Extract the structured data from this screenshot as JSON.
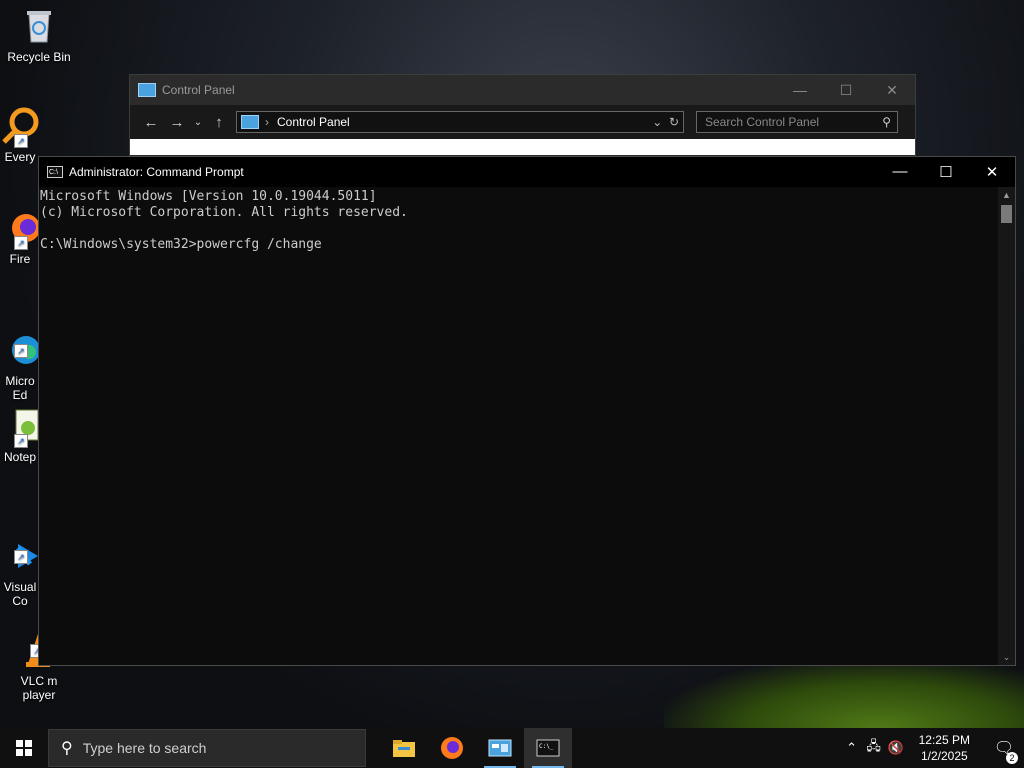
{
  "desktop": {
    "icons": [
      {
        "label": "Recycle Bin",
        "icon": "recycle-bin-icon"
      },
      {
        "label": "Every",
        "icon": "everything-icon"
      },
      {
        "label": "Fire",
        "icon": "firefox-icon"
      },
      {
        "label": "Micro\nEd",
        "icon": "edge-icon"
      },
      {
        "label": "Notep",
        "icon": "notepad-icon"
      },
      {
        "label": "Visual\nCo",
        "icon": "vscode-icon"
      },
      {
        "label": "VLC m\nplayer",
        "icon": "vlc-icon"
      }
    ]
  },
  "control_panel": {
    "title": "Control Panel",
    "address": "Control Panel",
    "search_placeholder": "Search Control Panel",
    "minimize": "—",
    "maximize": "☐",
    "close": "✕"
  },
  "cmd": {
    "title": "Administrator: Command Prompt",
    "minimize": "—",
    "maximize": "☐",
    "close": "✕",
    "lines": [
      "Microsoft Windows [Version 10.0.19044.5011]",
      "(c) Microsoft Corporation. All rights reserved.",
      "",
      "C:\\Windows\\system32>powercfg /change"
    ]
  },
  "taskbar": {
    "search_placeholder": "Type here to search",
    "apps": [
      "file-explorer-icon",
      "firefox-icon",
      "control-panel-icon",
      "command-prompt-icon"
    ],
    "active_app": "command-prompt-icon",
    "time": "12:25 PM",
    "date": "1/2/2025",
    "notification_count": "2"
  }
}
